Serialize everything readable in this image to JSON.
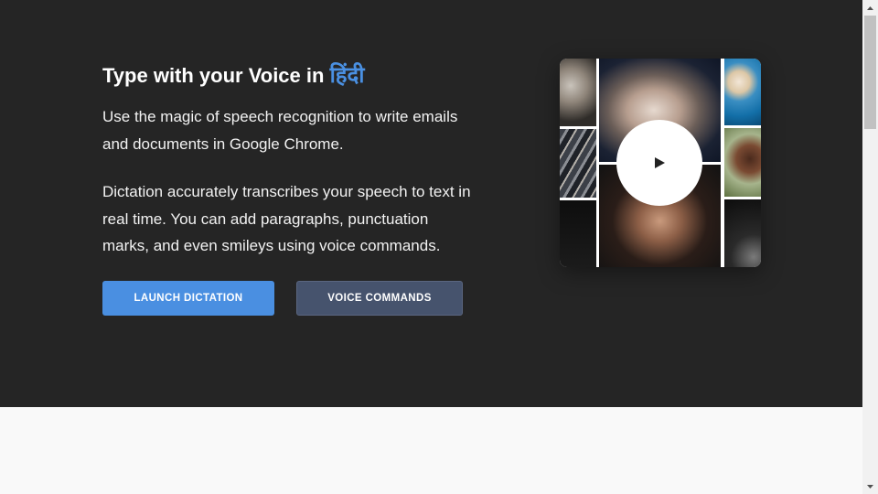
{
  "hero": {
    "headline_prefix": "Type with your Voice in",
    "headline_language": "हिंदी",
    "paragraph1": "Use the magic of speech recognition to write emails and documents in Google Chrome.",
    "paragraph2": "Dictation accurately transcribes your speech to text in real time. You can add paragraphs, punctuation marks, and even smileys using voice commands.",
    "launch_button": "LAUNCH DICTATION",
    "voice_button": "VOICE COMMANDS"
  },
  "video": {
    "play_icon": "play-icon"
  },
  "colors": {
    "hero_background": "#252525",
    "accent": "#4a90e2",
    "launch_button": "#4a8fe1",
    "voice_button": "#46536d",
    "page_background": "#f9f9f9"
  }
}
